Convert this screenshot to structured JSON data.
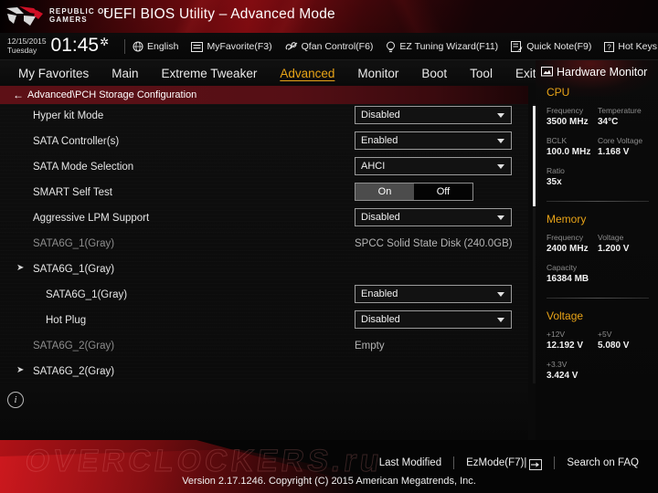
{
  "titlebar": {
    "logo_line1": "REPUBLIC OF",
    "logo_line2": "GAMERS",
    "app_title": "UEFI BIOS Utility – Advanced Mode"
  },
  "utilbar": {
    "date": "12/15/2015",
    "weekday": "Tuesday",
    "time": "01:45",
    "items": [
      {
        "label": "English",
        "icon": "globe-icon"
      },
      {
        "label": "MyFavorite(F3)",
        "icon": "star-window-icon"
      },
      {
        "label": "Qfan Control(F6)",
        "icon": "fan-icon"
      },
      {
        "label": "EZ Tuning Wizard(F11)",
        "icon": "bulb-icon"
      },
      {
        "label": "Quick Note(F9)",
        "icon": "note-icon"
      },
      {
        "label": "Hot Keys",
        "icon": "question-icon"
      }
    ]
  },
  "nav": {
    "tabs": [
      {
        "label": "My Favorites",
        "active": false
      },
      {
        "label": "Main",
        "active": false
      },
      {
        "label": "Extreme Tweaker",
        "active": false
      },
      {
        "label": "Advanced",
        "active": true
      },
      {
        "label": "Monitor",
        "active": false
      },
      {
        "label": "Boot",
        "active": false
      },
      {
        "label": "Tool",
        "active": false
      },
      {
        "label": "Exit",
        "active": false
      }
    ]
  },
  "breadcrumb": {
    "back_icon": "back-arrow-icon",
    "path": "Advanced\\PCH Storage Configuration"
  },
  "settings": {
    "rows": [
      {
        "label": "Hyper kit Mode",
        "indent": 36,
        "dim": false,
        "bullet": false,
        "control": "dropdown",
        "value": "Disabled"
      },
      {
        "label": "SATA Controller(s)",
        "indent": 36,
        "dim": false,
        "bullet": false,
        "control": "dropdown",
        "value": "Enabled"
      },
      {
        "label": "SATA Mode Selection",
        "indent": 36,
        "dim": false,
        "bullet": false,
        "control": "dropdown",
        "value": "AHCI"
      },
      {
        "label": "SMART Self Test",
        "indent": 36,
        "dim": false,
        "bullet": false,
        "control": "toggle",
        "on_label": "On",
        "off_label": "Off",
        "value": "On"
      },
      {
        "label": "Aggressive LPM Support",
        "indent": 36,
        "dim": false,
        "bullet": false,
        "control": "dropdown",
        "value": "Disabled"
      },
      {
        "label": "SATA6G_1(Gray)",
        "indent": 36,
        "dim": true,
        "bullet": false,
        "control": "text",
        "value": "SPCC Solid State Disk (240.0GB)"
      },
      {
        "label": "SATA6G_1(Gray)",
        "indent": 36,
        "dim": false,
        "bullet": true,
        "control": "none",
        "value": ""
      },
      {
        "label": "SATA6G_1(Gray)",
        "indent": 50,
        "dim": false,
        "bullet": false,
        "control": "dropdown",
        "value": "Enabled"
      },
      {
        "label": "Hot Plug",
        "indent": 50,
        "dim": false,
        "bullet": false,
        "control": "dropdown",
        "value": "Disabled"
      },
      {
        "label": "SATA6G_2(Gray)",
        "indent": 36,
        "dim": true,
        "bullet": false,
        "control": "text",
        "value": "Empty"
      },
      {
        "label": "SATA6G_2(Gray)",
        "indent": 36,
        "dim": false,
        "bullet": true,
        "control": "none",
        "value": ""
      },
      {
        "label": "",
        "indent": 50,
        "dim": false,
        "bullet": false,
        "control": "dropdown-partial",
        "value": ""
      }
    ]
  },
  "hardware_monitor": {
    "title": "Hardware Monitor",
    "icon": "monitor-icon",
    "sections": [
      {
        "name": "CPU",
        "pairs": [
          {
            "label": "Frequency",
            "value": "3500 MHz"
          },
          {
            "label": "Temperature",
            "value": "34°C"
          },
          {
            "label": "BCLK",
            "value": "100.0 MHz"
          },
          {
            "label": "Core Voltage",
            "value": "1.168 V"
          },
          {
            "label": "Ratio",
            "value": "35x"
          }
        ]
      },
      {
        "name": "Memory",
        "pairs": [
          {
            "label": "Frequency",
            "value": "2400 MHz"
          },
          {
            "label": "Voltage",
            "value": "1.200 V"
          },
          {
            "label": "Capacity",
            "value": "16384 MB"
          }
        ]
      },
      {
        "name": "Voltage",
        "pairs": [
          {
            "label": "+12V",
            "value": "12.192 V"
          },
          {
            "label": "+5V",
            "value": "5.080 V"
          },
          {
            "label": "+3.3V",
            "value": "3.424 V"
          }
        ]
      }
    ]
  },
  "footer": {
    "info_icon": "info-icon",
    "watermark": "OVERCLOCKERS.ru",
    "last_modified": "Last Modified",
    "ezmode": "EzMode(F7)|",
    "search_faq": "Search on FAQ",
    "version": "Version 2.17.1246. Copyright (C) 2015 American Megatrends, Inc."
  },
  "colors": {
    "accent_orange": "#e8a317",
    "brand_red": "#cd141a",
    "bg": "#0a0a0a"
  }
}
